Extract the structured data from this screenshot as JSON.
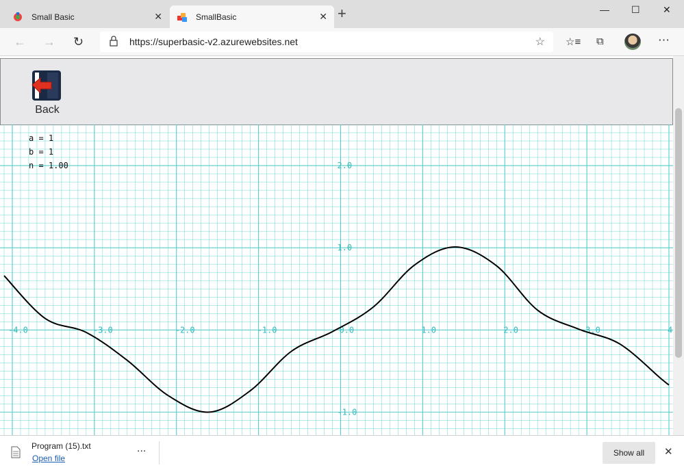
{
  "browser": {
    "tabs": [
      {
        "title": "Small Basic",
        "active": false
      },
      {
        "title": "SmallBasic",
        "active": true
      }
    ],
    "new_tab": "+",
    "address": "https://superbasic-v2.azurewebsites.net",
    "window_controls": [
      "minimize-icon",
      "maximize-icon",
      "close-icon"
    ]
  },
  "app": {
    "back_label": "Back",
    "params": {
      "a": "a = 1",
      "b": "b = 1",
      "n": "n = 1.00"
    },
    "graph": {
      "x_ticks": [
        "-4.0",
        "-3.0",
        "-2.0",
        "-1.0",
        "0.0",
        "1.0",
        "2.0",
        "3.0",
        "4"
      ],
      "y_ticks": [
        "2.0",
        "1.0",
        "-1.0"
      ],
      "grid_color": "#55cccc",
      "curve_color": "#000000"
    }
  },
  "chart_data": {
    "type": "line",
    "series": [
      {
        "x": [
          -4.1,
          -3.6,
          -3.1,
          -2.6,
          -2.1,
          -1.6,
          -1.1,
          -0.6,
          -0.1,
          0.4,
          0.9,
          1.4,
          1.9,
          2.4,
          2.9,
          3.4,
          3.9,
          4.0
        ],
        "y": [
          0.66,
          0.14,
          -0.03,
          -0.37,
          -0.8,
          -1.0,
          -0.74,
          -0.26,
          -0.02,
          0.28,
          0.79,
          1.01,
          0.78,
          0.24,
          0.01,
          -0.17,
          -0.59,
          -0.67
        ]
      }
    ],
    "xlim": [
      -4.15,
      4.05
    ],
    "ylim": [
      -1.28,
      2.5
    ],
    "grid": true,
    "xlabel": "",
    "ylabel": ""
  },
  "downloads": {
    "file_name": "Program (15).txt",
    "open_label": "Open file",
    "more": "...",
    "show_all": "Show all"
  }
}
